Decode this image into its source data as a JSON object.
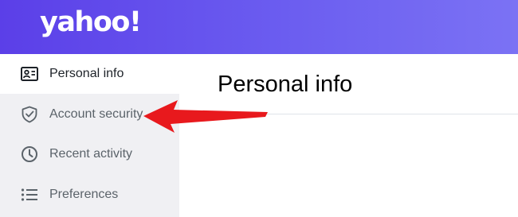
{
  "header": {
    "logo_text": "yahoo!",
    "gradient_colors": [
      "#5b3fe8",
      "#7b72f4"
    ]
  },
  "sidebar": {
    "items": [
      {
        "label": "Personal info",
        "icon": "id-card-icon",
        "active": true
      },
      {
        "label": "Account security",
        "icon": "shield-check-icon",
        "active": false
      },
      {
        "label": "Recent activity",
        "icon": "clock-icon",
        "active": false
      },
      {
        "label": "Preferences",
        "icon": "list-icon",
        "active": false
      }
    ]
  },
  "main": {
    "title": "Personal info"
  },
  "annotation": {
    "arrow_color": "#e8191d",
    "points_to": "Account security"
  }
}
